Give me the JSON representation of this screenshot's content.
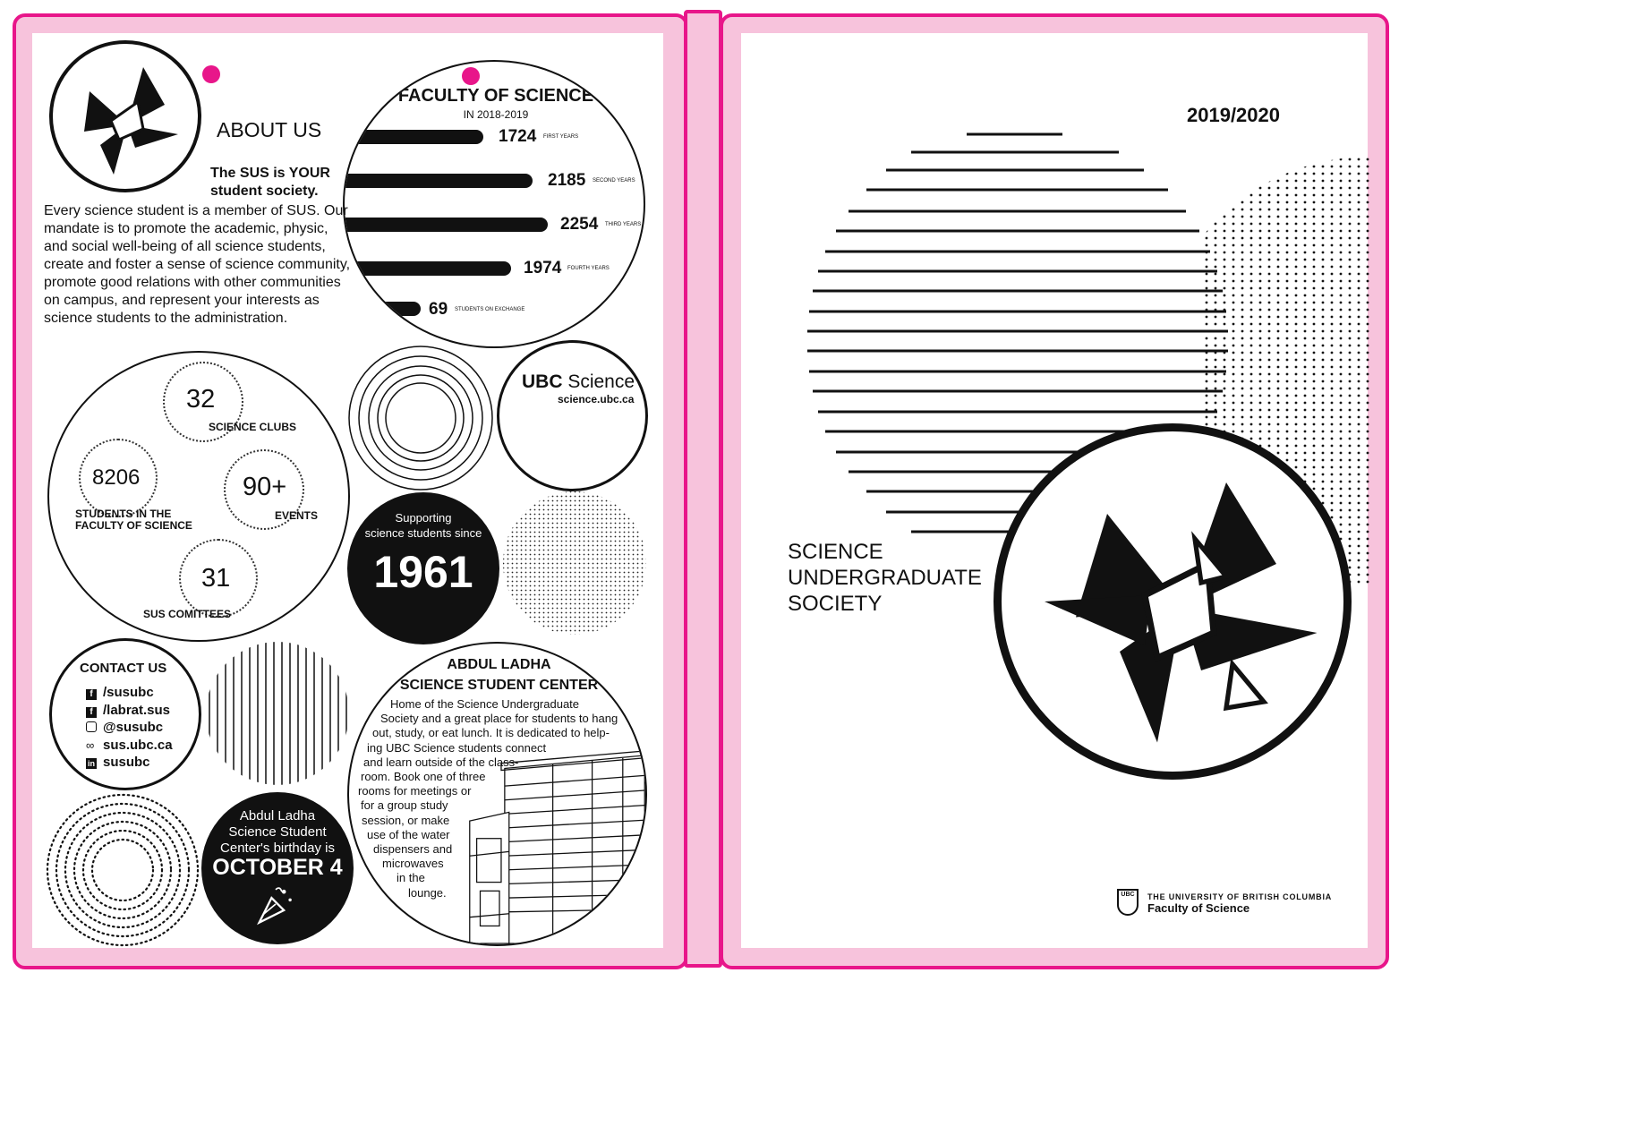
{
  "about": {
    "heading": "ABOUT US",
    "lead_line1": "The SUS is YOUR",
    "lead_line2": "student society.",
    "body": [
      "Every science student is a member of SUS. Our",
      "mandate is to promote the academic, physic,",
      "and social well-being of all science students,",
      "create and foster a sense of  science community,",
      "promote good relations with other communities",
      "on campus, and represent your interests as",
      "science students to the administration."
    ]
  },
  "faculty": {
    "title": "FACULTY OF SCIENCE",
    "subtitle": "IN 2018-2019",
    "rows": [
      {
        "value": "1724",
        "label": "FIRST YEARS"
      },
      {
        "value": "2185",
        "label": "SECOND YEARS"
      },
      {
        "value": "2254",
        "label": "THIRD YEARS"
      },
      {
        "value": "1974",
        "label": "FOURTH YEARS"
      },
      {
        "value": "69",
        "label": "STUDENTS ON EXCHANGE"
      }
    ]
  },
  "stats": {
    "clubs_value": "32",
    "clubs_label": "SCIENCE CLUBS",
    "students_value": "8206",
    "students_label_1": "STUDENTS IN THE",
    "students_label_2": "FACULTY OF SCIENCE",
    "events_value": "90+",
    "events_label": "EVENTS",
    "committees_value": "31",
    "committees_label": "SUS COMITTEES"
  },
  "ubc": {
    "name_bold": "UBC",
    "name_rest": " Science",
    "url": "science.ubc.ca"
  },
  "supporting": {
    "line1": "Supporting",
    "line2": "science students since",
    "year": "1961"
  },
  "contact": {
    "title": "CONTACT US",
    "items": [
      {
        "icon": "facebook-icon",
        "text": "/susubc"
      },
      {
        "icon": "facebook-icon",
        "text": "/labrat.sus"
      },
      {
        "icon": "instagram-icon",
        "text": "@susubc"
      },
      {
        "icon": "link-icon",
        "text": "sus.ubc.ca"
      },
      {
        "icon": "linkedin-icon",
        "text": "susubc"
      }
    ]
  },
  "birthday": {
    "line1": "Abdul Ladha",
    "line2": "Science Student",
    "line3": "Center's birthday is",
    "date": "OCTOBER 4"
  },
  "center": {
    "title1": "ABDUL LADHA",
    "title2": "SCIENCE STUDENT CENTER",
    "lines": [
      "Home of the Science Undergraduate",
      "Society and a great place for students to hang",
      "out, study, or eat lunch. It is dedicated to help-",
      "ing UBC Science students connect",
      "and learn outside of the class-",
      "room. Book one of three",
      "rooms for meetings or",
      "for a group study",
      "session, or make",
      "use of the water",
      "dispensers and",
      "microwaves",
      "in the",
      "lounge."
    ]
  },
  "cover": {
    "year": "2019/2020",
    "title_lines": [
      "SCIENCE",
      "UNDERGRADUATE",
      "SOCIETY"
    ],
    "ubc_mark": "UBC",
    "university": "THE UNIVERSITY OF BRITISH COLUMBIA",
    "faculty": "Faculty of Science"
  },
  "colors": {
    "accent": "#e8168a",
    "pink": "#f7c3dc",
    "ink": "#111111"
  }
}
